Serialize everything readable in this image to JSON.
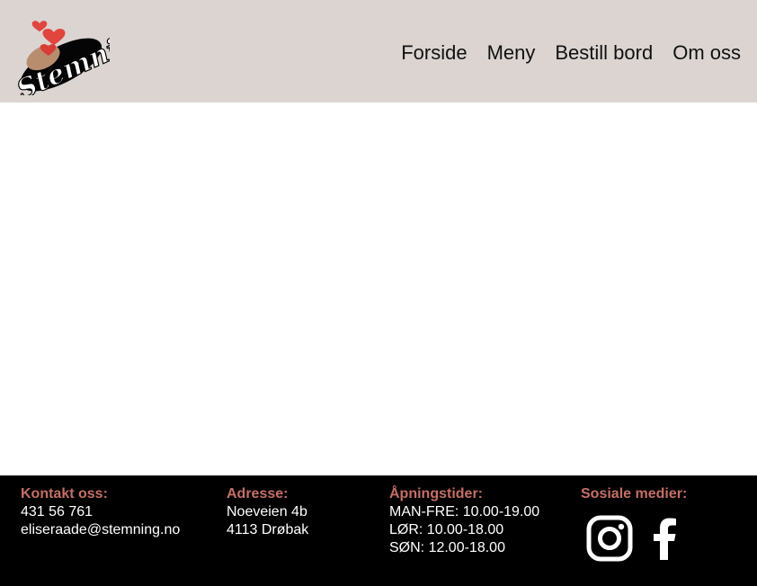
{
  "brand": {
    "logo_text": "Stemning",
    "colors": {
      "header_bg": "#dbd4d1",
      "footer_bg": "#000000",
      "accent": "#c46f66",
      "heart": "#e0453e"
    }
  },
  "nav": {
    "items": [
      {
        "label": "Forside"
      },
      {
        "label": "Meny"
      },
      {
        "label": "Bestill bord"
      },
      {
        "label": "Om oss"
      }
    ]
  },
  "footer": {
    "contact": {
      "heading": "Kontakt oss:",
      "phone": "431 56 761",
      "email": "eliseraade@stemning.no"
    },
    "address": {
      "heading": "Adresse:",
      "street": "Noeveien 4b",
      "city": "4113 Drøbak"
    },
    "hours": {
      "heading": "Åpningstider:",
      "weekdays": "MAN-FRE: 10.00-19.00",
      "saturday": "LØR: 10.00-18.00",
      "sunday": "SØN: 12.00-18.00"
    },
    "social": {
      "heading": "Sosiale medier:",
      "icons": [
        "instagram-icon",
        "facebook-icon"
      ]
    }
  }
}
